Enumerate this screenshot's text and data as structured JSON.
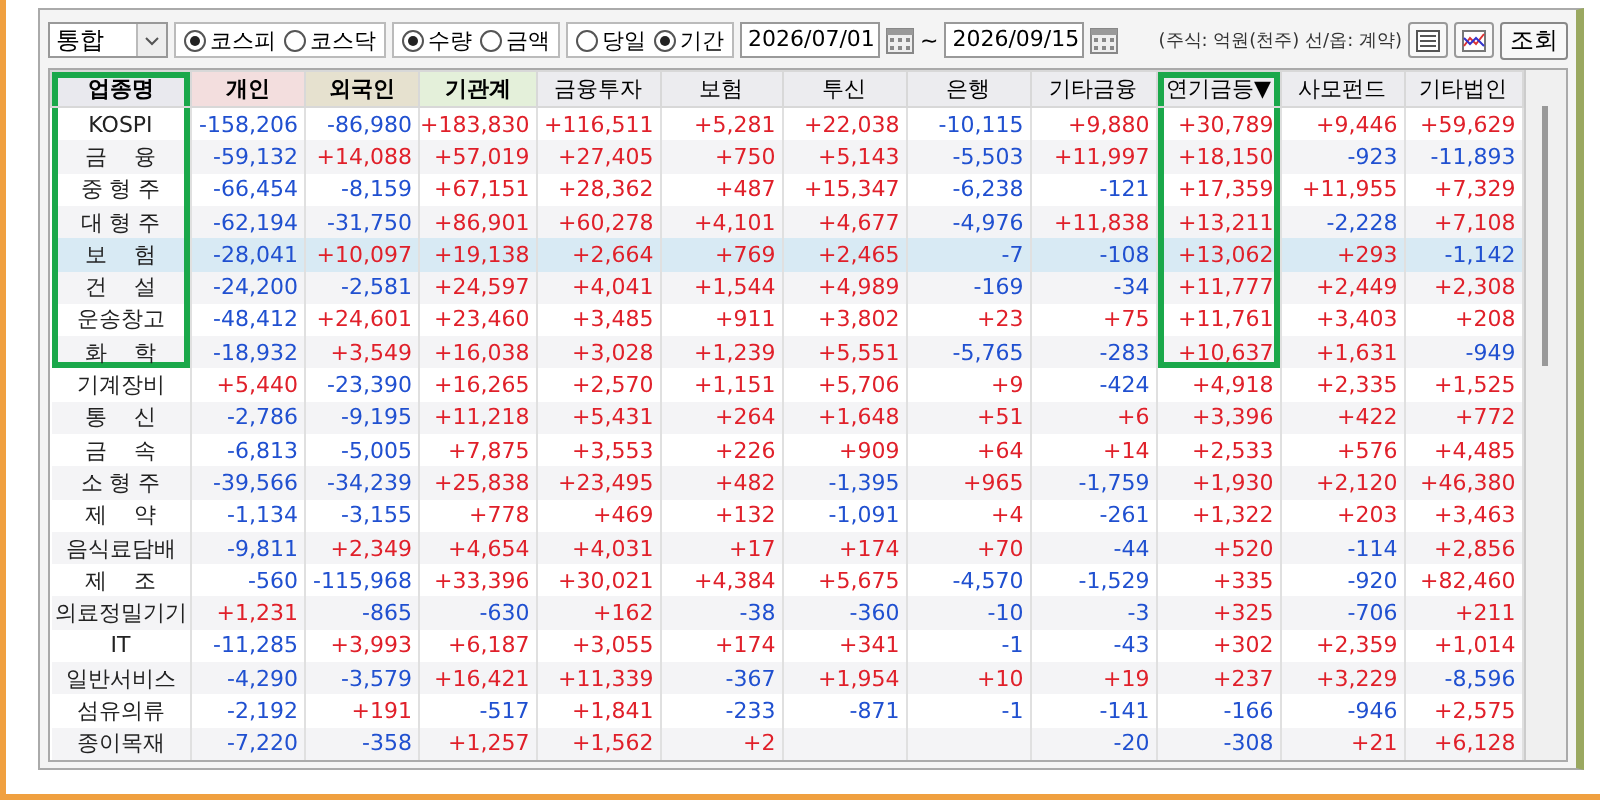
{
  "toolbar": {
    "market_dropdown": {
      "value": "통합"
    },
    "radio_groups": [
      [
        {
          "label": "코스피",
          "selected": true
        },
        {
          "label": "코스닥",
          "selected": false
        }
      ],
      [
        {
          "label": "수량",
          "selected": true
        },
        {
          "label": "금액",
          "selected": false
        }
      ],
      [
        {
          "label": "당일",
          "selected": false
        },
        {
          "label": "기간",
          "selected": true
        }
      ]
    ],
    "date_from": "2026/07/01",
    "date_separator": "~",
    "date_to": "2026/09/15",
    "unit_note": "(주식: 억원(천주) 선/옵: 계약)",
    "buttons": [
      {
        "kind": "list"
      },
      {
        "kind": "chart"
      },
      {
        "kind": "text",
        "label": "조회"
      }
    ]
  },
  "table": {
    "columns": [
      {
        "label": "업종명",
        "kind": "name",
        "highlighted": true
      },
      {
        "label": "개인",
        "kind": "individual",
        "highlighted": false
      },
      {
        "label": "외국인",
        "kind": "foreign",
        "highlighted": false
      },
      {
        "label": "기관계",
        "kind": "institution",
        "highlighted": false
      },
      {
        "label": "금융투자",
        "kind": "other",
        "highlighted": false
      },
      {
        "label": "보험",
        "kind": "other",
        "highlighted": false
      },
      {
        "label": "투신",
        "kind": "other",
        "highlighted": false
      },
      {
        "label": "은행",
        "kind": "other",
        "highlighted": false
      },
      {
        "label": "기타금융",
        "kind": "other",
        "highlighted": false
      },
      {
        "label": "연기금등▼",
        "kind": "other",
        "highlighted": true
      },
      {
        "label": "사모펀드",
        "kind": "other",
        "highlighted": false
      },
      {
        "label": "기타법인",
        "kind": "other",
        "highlighted": false
      }
    ],
    "rows": [
      {
        "name": "KOSPI",
        "selected": false,
        "highlighted": true,
        "values": [
          "-158,206",
          "-86,980",
          "+183,830",
          "+116,511",
          "+5,281",
          "+22,038",
          "-10,115",
          "+9,880",
          "+30,789",
          "+9,446",
          "+59,629"
        ]
      },
      {
        "name": "금    융",
        "selected": false,
        "highlighted": true,
        "values": [
          "-59,132",
          "+14,088",
          "+57,019",
          "+27,405",
          "+750",
          "+5,143",
          "-5,503",
          "+11,997",
          "+18,150",
          "-923",
          "-11,893"
        ]
      },
      {
        "name": "중 형 주",
        "selected": false,
        "highlighted": true,
        "values": [
          "-66,454",
          "-8,159",
          "+67,151",
          "+28,362",
          "+487",
          "+15,347",
          "-6,238",
          "-121",
          "+17,359",
          "+11,955",
          "+7,329"
        ]
      },
      {
        "name": "대 형 주",
        "selected": false,
        "highlighted": true,
        "values": [
          "-62,194",
          "-31,750",
          "+86,901",
          "+60,278",
          "+4,101",
          "+4,677",
          "-4,976",
          "+11,838",
          "+13,211",
          "-2,228",
          "+7,108"
        ]
      },
      {
        "name": "보    험",
        "selected": true,
        "highlighted": true,
        "values": [
          "-28,041",
          "+10,097",
          "+19,138",
          "+2,664",
          "+769",
          "+2,465",
          "-7",
          "-108",
          "+13,062",
          "+293",
          "-1,142"
        ]
      },
      {
        "name": "건    설",
        "selected": false,
        "highlighted": true,
        "values": [
          "-24,200",
          "-2,581",
          "+24,597",
          "+4,041",
          "+1,544",
          "+4,989",
          "-169",
          "-34",
          "+11,777",
          "+2,449",
          "+2,308"
        ]
      },
      {
        "name": "운송창고",
        "selected": false,
        "highlighted": true,
        "values": [
          "-48,412",
          "+24,601",
          "+23,460",
          "+3,485",
          "+911",
          "+3,802",
          "+23",
          "+75",
          "+11,761",
          "+3,403",
          "+208"
        ]
      },
      {
        "name": "화    학",
        "selected": false,
        "highlighted": true,
        "values": [
          "-18,932",
          "+3,549",
          "+16,038",
          "+3,028",
          "+1,239",
          "+5,551",
          "-5,765",
          "-283",
          "+10,637",
          "+1,631",
          "-949"
        ]
      },
      {
        "name": "기계장비",
        "selected": false,
        "highlighted": false,
        "values": [
          "+5,440",
          "-23,390",
          "+16,265",
          "+2,570",
          "+1,151",
          "+5,706",
          "+9",
          "-424",
          "+4,918",
          "+2,335",
          "+1,525"
        ]
      },
      {
        "name": "통    신",
        "selected": false,
        "highlighted": false,
        "values": [
          "-2,786",
          "-9,195",
          "+11,218",
          "+5,431",
          "+264",
          "+1,648",
          "+51",
          "+6",
          "+3,396",
          "+422",
          "+772"
        ]
      },
      {
        "name": "금    속",
        "selected": false,
        "highlighted": false,
        "values": [
          "-6,813",
          "-5,005",
          "+7,875",
          "+3,553",
          "+226",
          "+909",
          "+64",
          "+14",
          "+2,533",
          "+576",
          "+4,485"
        ]
      },
      {
        "name": "소 형 주",
        "selected": false,
        "highlighted": false,
        "values": [
          "-39,566",
          "-34,239",
          "+25,838",
          "+23,495",
          "+482",
          "-1,395",
          "+965",
          "-1,759",
          "+1,930",
          "+2,120",
          "+46,380"
        ]
      },
      {
        "name": "제    약",
        "selected": false,
        "highlighted": false,
        "values": [
          "-1,134",
          "-3,155",
          "+778",
          "+469",
          "+132",
          "-1,091",
          "+4",
          "-261",
          "+1,322",
          "+203",
          "+3,463"
        ]
      },
      {
        "name": "음식료담배",
        "selected": false,
        "highlighted": false,
        "values": [
          "-9,811",
          "+2,349",
          "+4,654",
          "+4,031",
          "+17",
          "+174",
          "+70",
          "-44",
          "+520",
          "-114",
          "+2,856"
        ]
      },
      {
        "name": "제    조",
        "selected": false,
        "highlighted": false,
        "values": [
          "-560",
          "-115,968",
          "+33,396",
          "+30,021",
          "+4,384",
          "+5,675",
          "-4,570",
          "-1,529",
          "+335",
          "-920",
          "+82,460"
        ]
      },
      {
        "name": "의료정밀기기",
        "selected": false,
        "highlighted": false,
        "values": [
          "+1,231",
          "-865",
          "-630",
          "+162",
          "-38",
          "-360",
          "-10",
          "-3",
          "+325",
          "-706",
          "+211"
        ]
      },
      {
        "name": "IT",
        "selected": false,
        "highlighted": false,
        "values": [
          "-11,285",
          "+3,993",
          "+6,187",
          "+3,055",
          "+174",
          "+341",
          "-1",
          "-43",
          "+302",
          "+2,359",
          "+1,014"
        ]
      },
      {
        "name": "일반서비스",
        "selected": false,
        "highlighted": false,
        "values": [
          "-4,290",
          "-3,579",
          "+16,421",
          "+11,339",
          "-367",
          "+1,954",
          "+10",
          "+19",
          "+237",
          "+3,229",
          "-8,596"
        ]
      },
      {
        "name": "섬유의류",
        "selected": false,
        "highlighted": false,
        "values": [
          "-2,192",
          "+191",
          "-517",
          "+1,841",
          "-233",
          "-871",
          "-1",
          "-141",
          "-166",
          "-946",
          "+2,575"
        ]
      },
      {
        "name": "종이목재",
        "selected": false,
        "highlighted": false,
        "values": [
          "-7,220",
          "-358",
          "+1,257",
          "+1,562",
          "+2",
          {
            "kind": "blank"
          },
          {
            "kind": "blank"
          },
          "-20",
          "-308",
          "+21",
          "+6,128"
        ]
      }
    ]
  }
}
